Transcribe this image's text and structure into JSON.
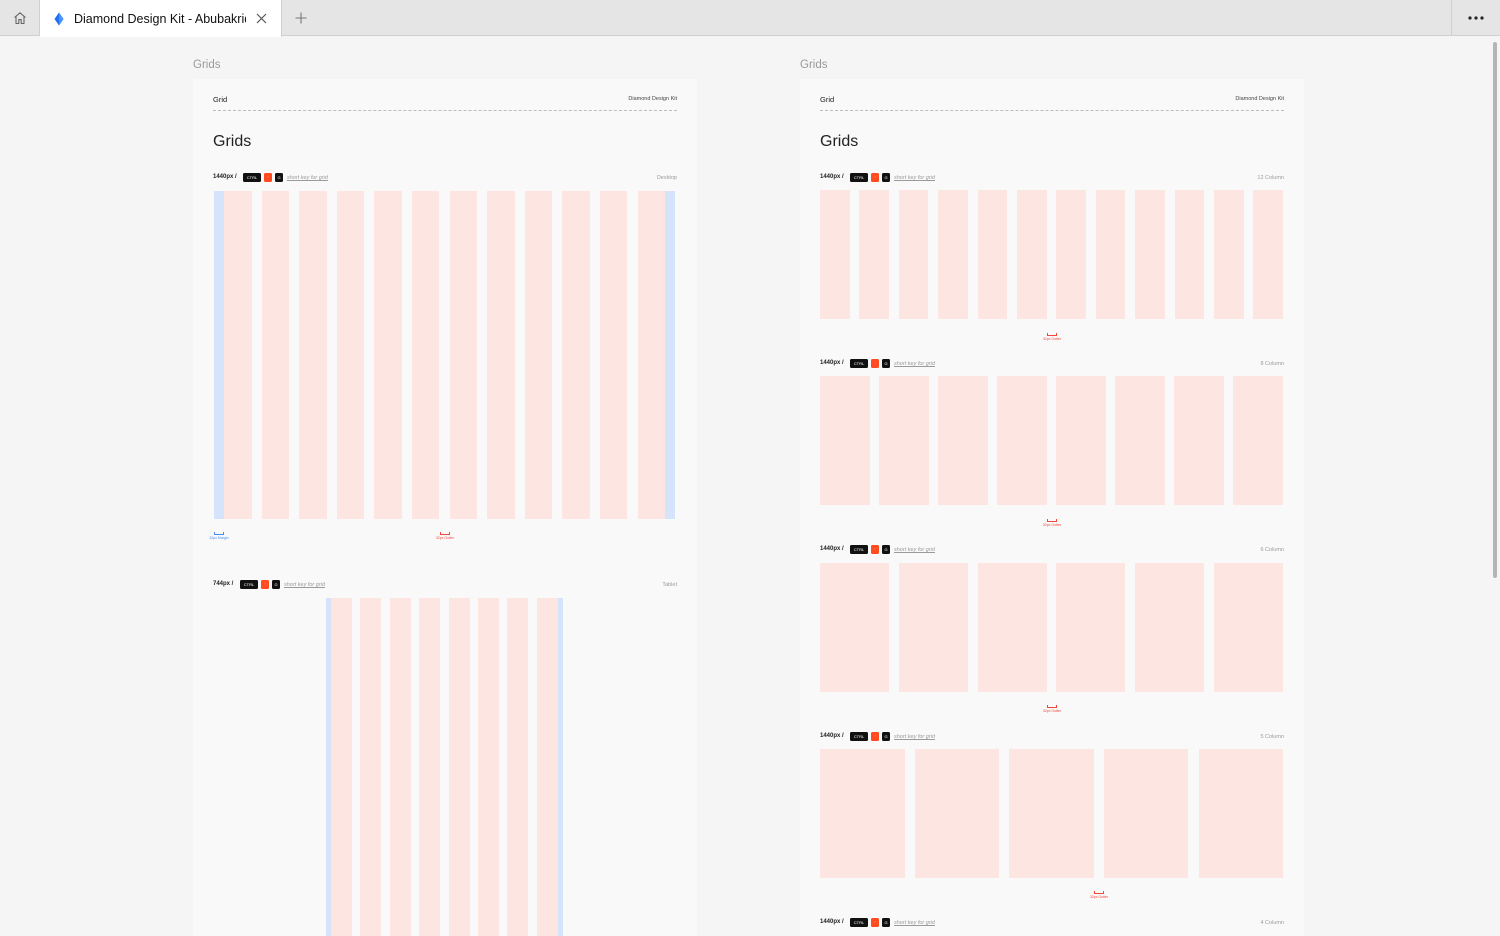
{
  "tab": {
    "title": "Diamond Design Kit - Abubakriqb",
    "icon": "diamond-icon"
  },
  "frames": [
    {
      "label": "Grids",
      "header_left": "Grid",
      "header_right": "Diamond Design Kit",
      "title": "Grids",
      "sections": [
        {
          "size": "1440px /",
          "keys": [
            "CTRL",
            "'",
            "G"
          ],
          "hint": "short key for grid",
          "right": "Desktop",
          "columns": 12,
          "margin_label": "32px Margin",
          "gutter_label": "32px Gutter"
        },
        {
          "size": "744px /",
          "keys": [
            "CTRL",
            "'",
            "G"
          ],
          "hint": "short key for grid",
          "right": "Tablet",
          "columns": 8
        }
      ]
    },
    {
      "label": "Grids",
      "header_left": "Grid",
      "header_right": "Diamond Design Kit",
      "title": "Grids",
      "sections": [
        {
          "size": "1440px /",
          "keys": [
            "CTRL",
            "'",
            "G"
          ],
          "hint": "short key for grid",
          "right": "12 Column",
          "columns": 12,
          "gutter_label": "32px Gutter"
        },
        {
          "size": "1440px /",
          "keys": [
            "CTRL",
            "'",
            "G"
          ],
          "hint": "short key for grid",
          "right": "8 Column",
          "columns": 8,
          "gutter_label": "32px Gutter"
        },
        {
          "size": "1440px /",
          "keys": [
            "CTRL",
            "'",
            "G"
          ],
          "hint": "short key for grid",
          "right": "6 Column",
          "columns": 6,
          "gutter_label": "32px Gutter"
        },
        {
          "size": "1440px /",
          "keys": [
            "CTRL",
            "'",
            "G"
          ],
          "hint": "short key for grid",
          "right": "5 Column",
          "columns": 5,
          "gutter_label": "32px Gutter"
        },
        {
          "size": "1440px /",
          "keys": [
            "CTRL",
            "'",
            "G"
          ],
          "hint": "short key for grid",
          "right": "4 Column"
        }
      ]
    }
  ],
  "colors": {
    "column": "#fde6e1",
    "margin": "#d6e4fb",
    "gutter_marker": "#f0483e",
    "margin_marker": "#4a8df0",
    "accent": "#ff4b1f"
  }
}
